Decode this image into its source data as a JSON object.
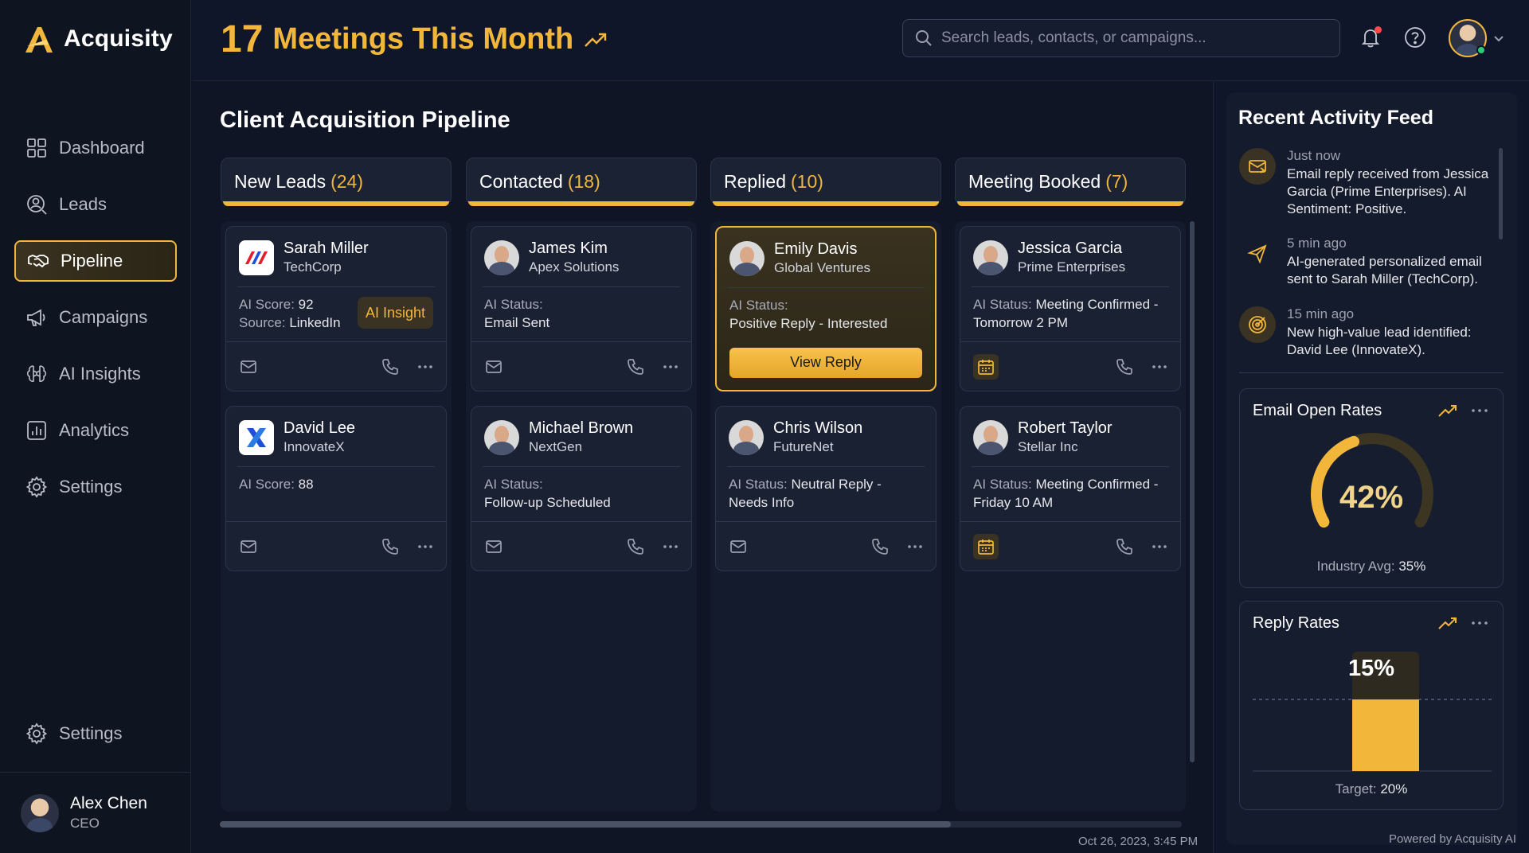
{
  "brand": {
    "name": "Acquisity"
  },
  "header": {
    "meetings_count": "17",
    "meetings_label": "Meetings This Month",
    "search_placeholder": "Search leads, contacts, or campaigns..."
  },
  "sidebar": {
    "items": [
      {
        "label": "Dashboard",
        "icon": "dashboard-icon"
      },
      {
        "label": "Leads",
        "icon": "leads-icon"
      },
      {
        "label": "Pipeline",
        "icon": "handshake-icon",
        "active": true
      },
      {
        "label": "Campaigns",
        "icon": "megaphone-icon"
      },
      {
        "label": "AI Insights",
        "icon": "brain-icon"
      },
      {
        "label": "Analytics",
        "icon": "analytics-icon"
      },
      {
        "label": "Settings",
        "icon": "gear-icon"
      }
    ],
    "bottom_item": {
      "label": "Settings",
      "icon": "gear-icon"
    },
    "user": {
      "name": "Alex Chen",
      "role": "CEO"
    }
  },
  "pipeline": {
    "title": "Client Acquisition Pipeline",
    "columns": [
      {
        "name": "New Leads",
        "count": "(24)",
        "cards": [
          {
            "name": "Sarah Miller",
            "company": "TechCorp",
            "line1_label": "AI Score: ",
            "line1_value": "92",
            "line2_label": "Source: ",
            "line2_value": "LinkedIn",
            "insight": "AI Insight"
          },
          {
            "name": "David Lee",
            "company": "InnovateX",
            "line1_label": "AI Score: ",
            "line1_value": "88"
          }
        ]
      },
      {
        "name": "Contacted",
        "count": "(18)",
        "cards": [
          {
            "name": "James Kim",
            "company": "Apex Solutions",
            "line1_label": "AI Status:",
            "line2_value": "Email Sent"
          },
          {
            "name": "Michael Brown",
            "company": "NextGen",
            "line1_label": "AI Status:",
            "line2_value": "Follow-up Scheduled"
          }
        ]
      },
      {
        "name": "Replied",
        "count": "(10)",
        "cards": [
          {
            "name": "Emily Davis",
            "company": "Global Ventures",
            "line1_label": "AI Status:",
            "line2_value": "Positive Reply - Interested",
            "button": "View Reply"
          },
          {
            "name": "Chris Wilson",
            "company": "FutureNet",
            "line1_label": "AI Status: ",
            "line1_value": "Neutral Reply -",
            "line2_value": "Needs Info"
          }
        ]
      },
      {
        "name": "Meeting Booked",
        "count": "(7)",
        "cards": [
          {
            "name": "Jessica Garcia",
            "company": "Prime Enterprises",
            "line1_label": "AI Status: ",
            "line1_value": "Meeting Confirmed -",
            "line2_value": "Tomorrow 2 PM"
          },
          {
            "name": "Robert Taylor",
            "company": "Stellar Inc",
            "line1_label": "AI Status: ",
            "line1_value": "Meeting Confirmed -",
            "line2_value": "Friday 10 AM"
          }
        ]
      }
    ],
    "timestamp": "Oct 26, 2023, 3:45 PM"
  },
  "feed": {
    "title": "Recent Activity Feed",
    "items": [
      {
        "time": "Just now",
        "text": "Email reply received from Jessica Garcia (Prime Enterprises). AI Sentiment: Positive.",
        "icon": "mail-reply-icon"
      },
      {
        "time": "5 min ago",
        "text": "AI-generated personalized email sent to Sarah Miller (TechCorp).",
        "icon": "send-icon"
      },
      {
        "time": "15 min ago",
        "text": "New high-value lead identified: David Lee (InnovateX).",
        "icon": "target-icon"
      }
    ]
  },
  "metrics": {
    "open_rates": {
      "title": "Email Open Rates",
      "value": "42%",
      "fraction": 0.42,
      "avg_label": "Industry Avg: ",
      "avg_value": "35%"
    },
    "reply_rates": {
      "title": "Reply Rates",
      "value": "15%",
      "fraction": 0.15,
      "target_label": "Target: ",
      "target_value": "20%",
      "target_fraction": 0.2
    }
  },
  "footer": {
    "powered": "Powered by Acquisity AI"
  },
  "colors": {
    "accent": "#f2b63a",
    "background": "#101525",
    "online": "#2ecc71",
    "notification": "#ff4a4a"
  }
}
